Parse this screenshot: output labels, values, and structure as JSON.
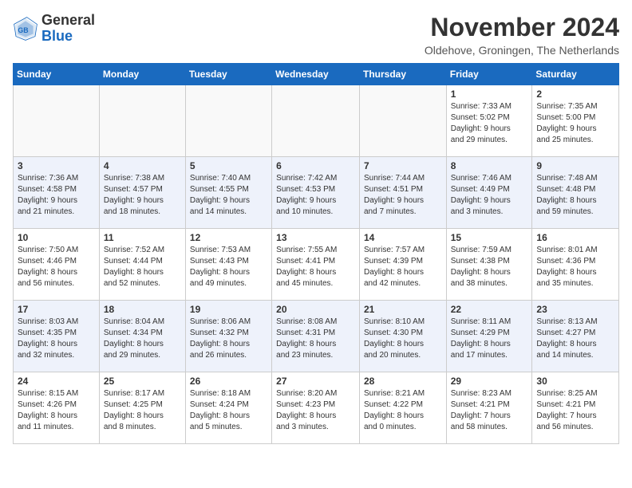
{
  "logo": {
    "line1": "General",
    "line2": "Blue"
  },
  "title": "November 2024",
  "location": "Oldehove, Groningen, The Netherlands",
  "days_header": [
    "Sunday",
    "Monday",
    "Tuesday",
    "Wednesday",
    "Thursday",
    "Friday",
    "Saturday"
  ],
  "weeks": [
    [
      {
        "day": "",
        "info": ""
      },
      {
        "day": "",
        "info": ""
      },
      {
        "day": "",
        "info": ""
      },
      {
        "day": "",
        "info": ""
      },
      {
        "day": "",
        "info": ""
      },
      {
        "day": "1",
        "info": "Sunrise: 7:33 AM\nSunset: 5:02 PM\nDaylight: 9 hours\nand 29 minutes."
      },
      {
        "day": "2",
        "info": "Sunrise: 7:35 AM\nSunset: 5:00 PM\nDaylight: 9 hours\nand 25 minutes."
      }
    ],
    [
      {
        "day": "3",
        "info": "Sunrise: 7:36 AM\nSunset: 4:58 PM\nDaylight: 9 hours\nand 21 minutes."
      },
      {
        "day": "4",
        "info": "Sunrise: 7:38 AM\nSunset: 4:57 PM\nDaylight: 9 hours\nand 18 minutes."
      },
      {
        "day": "5",
        "info": "Sunrise: 7:40 AM\nSunset: 4:55 PM\nDaylight: 9 hours\nand 14 minutes."
      },
      {
        "day": "6",
        "info": "Sunrise: 7:42 AM\nSunset: 4:53 PM\nDaylight: 9 hours\nand 10 minutes."
      },
      {
        "day": "7",
        "info": "Sunrise: 7:44 AM\nSunset: 4:51 PM\nDaylight: 9 hours\nand 7 minutes."
      },
      {
        "day": "8",
        "info": "Sunrise: 7:46 AM\nSunset: 4:49 PM\nDaylight: 9 hours\nand 3 minutes."
      },
      {
        "day": "9",
        "info": "Sunrise: 7:48 AM\nSunset: 4:48 PM\nDaylight: 8 hours\nand 59 minutes."
      }
    ],
    [
      {
        "day": "10",
        "info": "Sunrise: 7:50 AM\nSunset: 4:46 PM\nDaylight: 8 hours\nand 56 minutes."
      },
      {
        "day": "11",
        "info": "Sunrise: 7:52 AM\nSunset: 4:44 PM\nDaylight: 8 hours\nand 52 minutes."
      },
      {
        "day": "12",
        "info": "Sunrise: 7:53 AM\nSunset: 4:43 PM\nDaylight: 8 hours\nand 49 minutes."
      },
      {
        "day": "13",
        "info": "Sunrise: 7:55 AM\nSunset: 4:41 PM\nDaylight: 8 hours\nand 45 minutes."
      },
      {
        "day": "14",
        "info": "Sunrise: 7:57 AM\nSunset: 4:39 PM\nDaylight: 8 hours\nand 42 minutes."
      },
      {
        "day": "15",
        "info": "Sunrise: 7:59 AM\nSunset: 4:38 PM\nDaylight: 8 hours\nand 38 minutes."
      },
      {
        "day": "16",
        "info": "Sunrise: 8:01 AM\nSunset: 4:36 PM\nDaylight: 8 hours\nand 35 minutes."
      }
    ],
    [
      {
        "day": "17",
        "info": "Sunrise: 8:03 AM\nSunset: 4:35 PM\nDaylight: 8 hours\nand 32 minutes."
      },
      {
        "day": "18",
        "info": "Sunrise: 8:04 AM\nSunset: 4:34 PM\nDaylight: 8 hours\nand 29 minutes."
      },
      {
        "day": "19",
        "info": "Sunrise: 8:06 AM\nSunset: 4:32 PM\nDaylight: 8 hours\nand 26 minutes."
      },
      {
        "day": "20",
        "info": "Sunrise: 8:08 AM\nSunset: 4:31 PM\nDaylight: 8 hours\nand 23 minutes."
      },
      {
        "day": "21",
        "info": "Sunrise: 8:10 AM\nSunset: 4:30 PM\nDaylight: 8 hours\nand 20 minutes."
      },
      {
        "day": "22",
        "info": "Sunrise: 8:11 AM\nSunset: 4:29 PM\nDaylight: 8 hours\nand 17 minutes."
      },
      {
        "day": "23",
        "info": "Sunrise: 8:13 AM\nSunset: 4:27 PM\nDaylight: 8 hours\nand 14 minutes."
      }
    ],
    [
      {
        "day": "24",
        "info": "Sunrise: 8:15 AM\nSunset: 4:26 PM\nDaylight: 8 hours\nand 11 minutes."
      },
      {
        "day": "25",
        "info": "Sunrise: 8:17 AM\nSunset: 4:25 PM\nDaylight: 8 hours\nand 8 minutes."
      },
      {
        "day": "26",
        "info": "Sunrise: 8:18 AM\nSunset: 4:24 PM\nDaylight: 8 hours\nand 5 minutes."
      },
      {
        "day": "27",
        "info": "Sunrise: 8:20 AM\nSunset: 4:23 PM\nDaylight: 8 hours\nand 3 minutes."
      },
      {
        "day": "28",
        "info": "Sunrise: 8:21 AM\nSunset: 4:22 PM\nDaylight: 8 hours\nand 0 minutes."
      },
      {
        "day": "29",
        "info": "Sunrise: 8:23 AM\nSunset: 4:21 PM\nDaylight: 7 hours\nand 58 minutes."
      },
      {
        "day": "30",
        "info": "Sunrise: 8:25 AM\nSunset: 4:21 PM\nDaylight: 7 hours\nand 56 minutes."
      }
    ]
  ]
}
